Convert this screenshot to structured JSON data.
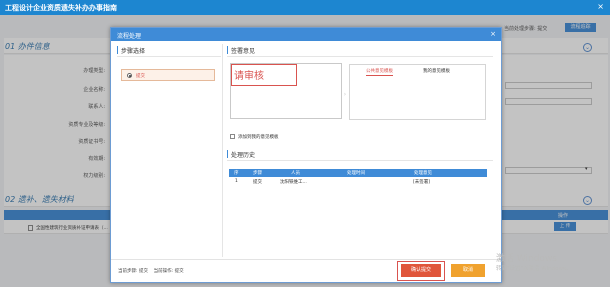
{
  "window": {
    "title": "工程设计企业资质遗失补办办事指南"
  },
  "background": {
    "current_step_label": "当前处理步骤: 提交",
    "flow_tracking_button": "流程追踪",
    "section1": {
      "index": "01",
      "title": "办件信息"
    },
    "fields": [
      {
        "label": "办理类型:"
      },
      {
        "label": "企业名称:"
      },
      {
        "label": "联系人:"
      },
      {
        "label": "资质专业及等级:"
      },
      {
        "label": "资质证书号:"
      },
      {
        "label": "有效期:"
      },
      {
        "label": "权力级别:"
      }
    ],
    "section2": {
      "index": "02",
      "title": "遗补、遗失材料"
    },
    "table_header_op": "操作",
    "material_row": {
      "name": "全国性建筑行业资质补证申请表（...",
      "upload": "上 传"
    }
  },
  "modal": {
    "title": "流程处理",
    "step_select_title": "步骤选择",
    "step_option": "提交",
    "opinion_title": "签署意见",
    "opinion_text": "请审核",
    "tabs": [
      "公共意见模板",
      "我的意见模板"
    ],
    "add_template_label": "添加到我的意见模板",
    "history_title": "处理历史",
    "history_columns": [
      "序",
      "步骤",
      "人员",
      "处理时间",
      "处理意见"
    ],
    "history_rows": [
      {
        "no": "1",
        "step": "提交",
        "person": "沈阳铁维工...",
        "time": "",
        "opinion": "[未签署]"
      }
    ],
    "footer_status": "当前步骤: 提交    当前操作: 提交",
    "confirm_button": "确认提交",
    "cancel_button": "取消"
  },
  "watermark": {
    "line1": "激活 Windows",
    "line2": "转到\"设置\"以激活 Windows。"
  },
  "colors": {
    "topbar": "#1d86d0",
    "modal_header": "#3f8bd7",
    "confirm": "#e0563b",
    "cancel": "#f0a22e",
    "highlight": "#d9534f"
  }
}
